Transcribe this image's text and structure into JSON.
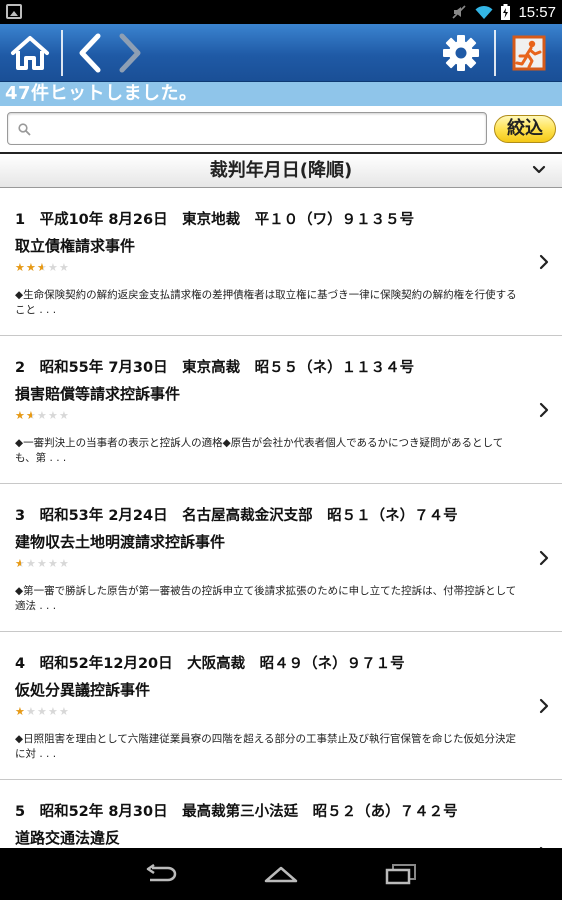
{
  "status_bar": {
    "time": "15:57"
  },
  "header": {
    "icons": [
      "home-icon",
      "back-icon",
      "forward-icon",
      "settings-icon",
      "exit-icon"
    ]
  },
  "hits_text": "47件ヒットしました。",
  "search": {
    "value": "",
    "placeholder": "",
    "filter_label": "絞込"
  },
  "sort_label": "裁判年月日(降順)",
  "results": [
    {
      "line1": "1　平成10年 8月26日　東京地裁　平１０（ワ）９１３５号",
      "title": "取立債権請求事件",
      "rating": 2.5,
      "max_rating": 5,
      "snippet": "◆生命保険契約の解約返戻金支払請求権の差押債権者は取立権に基づき一律に保険契約の解約権を行使すること . . ."
    },
    {
      "line1": "2　昭和55年 7月30日　東京高裁　昭５５（ネ）１１３４号",
      "title": "損害賠償等請求控訴事件",
      "rating": 1.5,
      "max_rating": 5,
      "snippet": "◆一審判決上の当事者の表示と控訴人の適格◆原告が会社か代表者個人であるかにつき疑問があるとしても、第 . . ."
    },
    {
      "line1": "3　昭和53年 2月24日　名古屋高裁金沢支部　昭５１（ネ）７４号",
      "title": "建物収去土地明渡請求控訴事件",
      "rating": 0.5,
      "max_rating": 5,
      "snippet": "◆第一審で勝訴した原告が第一審被告の控訴申立て後請求拡張のために申し立てた控訴は、付帯控訴として適法 . . ."
    },
    {
      "line1": "4　昭和52年12月20日　大阪高裁　昭４９（ネ）９７１号",
      "title": "仮処分異議控訴事件",
      "rating": 1,
      "max_rating": 5,
      "snippet": "◆日照阻害を理由として六階建従業員寮の四階を超える部分の工事禁止及び執行官保管を命じた仮処分決定に対 . . ."
    },
    {
      "line1": "5　昭和52年 8月30日　最高裁第三小法廷　昭５２（あ）７４２号",
      "title": "道路交通法違反",
      "rating": 1,
      "max_rating": 5,
      "snippet": ""
    }
  ],
  "colors": {
    "header_blue": "#1f5aa6",
    "hits_bar": "#8fc5ea",
    "star": "#e89a14",
    "filter_button": "#ffe354"
  }
}
